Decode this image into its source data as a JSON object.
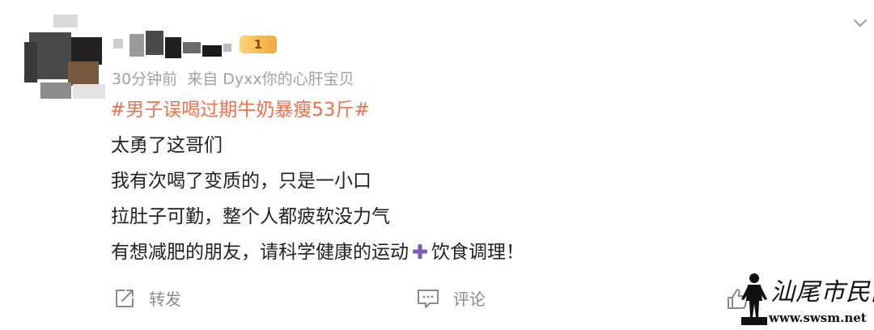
{
  "post": {
    "vip_badge": "1",
    "timestamp": "30分钟前",
    "source": "来自 Dyxx你的心肝宝贝",
    "topic": "#男子误喝过期牛奶暴瘦53斤#",
    "lines": [
      "太勇了这哥们",
      "我有次喝了变质的，只是一小口",
      "拉肚子可勤，整个人都疲软没力气",
      "有想减肥的朋友，请科学健康的运动",
      "饮食调理！"
    ]
  },
  "actions": {
    "repost_label": "转发",
    "comment_label": "评论"
  },
  "icons": {
    "collapse": "chevron-down-icon",
    "plus": "plus-icon",
    "repost": "repost-icon",
    "comment": "comment-icon",
    "like": "thumbs-up-icon"
  },
  "watermark": {
    "title": "汕尾市民网",
    "url": "www.swsm.net"
  },
  "colors": {
    "topic": "#eb7350",
    "meta": "#a1a1a1",
    "text": "#222222",
    "action": "#8a8a8a",
    "plus": "#7e5ab9"
  }
}
